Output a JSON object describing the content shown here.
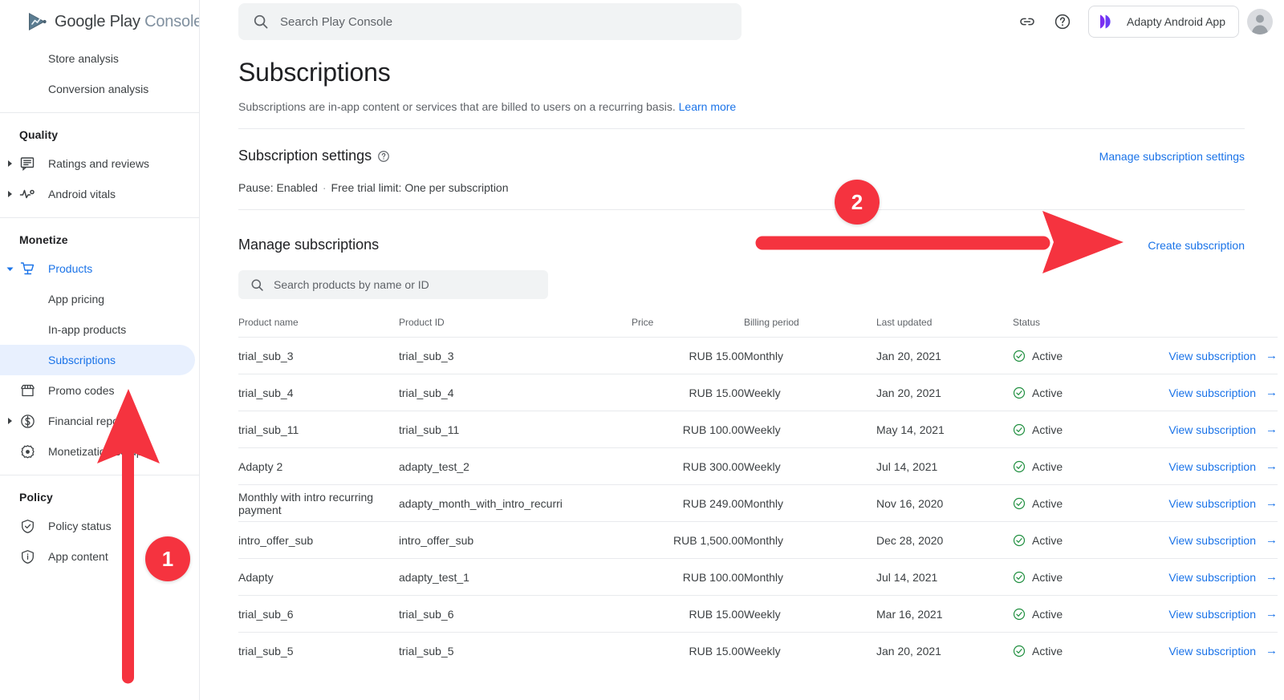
{
  "brand": {
    "name_primary": "Google Play",
    "name_secondary": "Console",
    "menu_icon": "hamburger-icon",
    "logo_icon": "google-play-logo-icon"
  },
  "topbar": {
    "search_placeholder": "Search Play Console",
    "search_value": "",
    "search_icon": "search-icon",
    "link_icon": "link-icon",
    "help_icon": "help-circle-icon",
    "app_name": "Adapty Android App",
    "app_icon": "adapty-app-icon",
    "avatar_icon": "account-avatar-icon"
  },
  "sidebar": {
    "items": [
      {
        "label": "Store analysis",
        "type": "sub",
        "icon": null,
        "state": "normal"
      },
      {
        "label": "Conversion analysis",
        "type": "sub",
        "icon": null,
        "state": "normal"
      }
    ],
    "sections": [
      {
        "title": "Quality",
        "items": [
          {
            "label": "Ratings and reviews",
            "icon": "ratings-reviews-icon",
            "caret": true,
            "state": "normal"
          },
          {
            "label": "Android vitals",
            "icon": "android-vitals-icon",
            "caret": true,
            "state": "normal"
          }
        ]
      },
      {
        "title": "Monetize",
        "items": [
          {
            "label": "Products",
            "icon": "shopping-cart-icon",
            "caret": true,
            "state": "expanded"
          },
          {
            "label": "App pricing",
            "icon": null,
            "caret": false,
            "state": "sub"
          },
          {
            "label": "In-app products",
            "icon": null,
            "caret": false,
            "state": "sub"
          },
          {
            "label": "Subscriptions",
            "icon": null,
            "caret": false,
            "state": "selected"
          },
          {
            "label": "Promo codes",
            "icon": "promo-codes-icon",
            "caret": false,
            "state": "normal"
          },
          {
            "label": "Financial reports",
            "icon": "financial-reports-icon",
            "caret": true,
            "state": "normal"
          },
          {
            "label": "Monetization setup",
            "icon": "monetization-setup-icon",
            "caret": false,
            "state": "normal"
          }
        ]
      },
      {
        "title": "Policy",
        "items": [
          {
            "label": "Policy status",
            "icon": "policy-status-icon",
            "caret": false,
            "state": "normal"
          },
          {
            "label": "App content",
            "icon": "app-content-icon",
            "caret": false,
            "state": "normal"
          }
        ]
      }
    ]
  },
  "page": {
    "title": "Subscriptions",
    "description": "Subscriptions are in-app content or services that are billed to users on a recurring basis.",
    "learn_more": "Learn more"
  },
  "subscription_settings": {
    "heading": "Subscription settings",
    "help_icon": "help-circle-icon",
    "manage_link": "Manage subscription settings",
    "pause": "Pause: Enabled",
    "separator": "·",
    "free_trial": "Free trial limit: One per subscription"
  },
  "manage_subscriptions": {
    "heading": "Manage subscriptions",
    "create_link": "Create subscription",
    "search_placeholder": "Search products by name or ID",
    "search_value": "",
    "search_icon": "search-icon",
    "columns": [
      "Product name",
      "Product ID",
      "Price",
      "Billing period",
      "Last updated",
      "Status"
    ],
    "action_label": "View subscription",
    "action_icon": "arrow-right-icon",
    "status_icon": "check-circle-icon",
    "rows": [
      {
        "name": "trial_sub_3",
        "id": "trial_sub_3",
        "price": "RUB 15.00",
        "billing": "Monthly",
        "updated": "Jan 20, 2021",
        "status": "Active",
        "action": "View subscription"
      },
      {
        "name": "trial_sub_4",
        "id": "trial_sub_4",
        "price": "RUB 15.00",
        "billing": "Weekly",
        "updated": "Jan 20, 2021",
        "status": "Active",
        "action": "View subscription"
      },
      {
        "name": "trial_sub_11",
        "id": "trial_sub_11",
        "price": "RUB 100.00",
        "billing": "Weekly",
        "updated": "May 14, 2021",
        "status": "Active",
        "action": "View subscription"
      },
      {
        "name": "Adapty 2",
        "id": "adapty_test_2",
        "price": "RUB 300.00",
        "billing": "Weekly",
        "updated": "Jul 14, 2021",
        "status": "Active",
        "action": "View subscription"
      },
      {
        "name": "Monthly with intro recurring payment",
        "id": "adapty_month_with_intro_recurri",
        "price": "RUB 249.00",
        "billing": "Monthly",
        "updated": "Nov 16, 2020",
        "status": "Active",
        "action": "View subscription"
      },
      {
        "name": "intro_offer_sub",
        "id": "intro_offer_sub",
        "price": "RUB 1,500.00",
        "billing": "Monthly",
        "updated": "Dec 28, 2020",
        "status": "Active",
        "action": "View subscription"
      },
      {
        "name": "Adapty",
        "id": "adapty_test_1",
        "price": "RUB 100.00",
        "billing": "Monthly",
        "updated": "Jul 14, 2021",
        "status": "Active",
        "action": "View subscription"
      },
      {
        "name": "trial_sub_6",
        "id": "trial_sub_6",
        "price": "RUB 15.00",
        "billing": "Weekly",
        "updated": "Mar 16, 2021",
        "status": "Active",
        "action": "View subscription"
      },
      {
        "name": "trial_sub_5",
        "id": "trial_sub_5",
        "price": "RUB 15.00",
        "billing": "Weekly",
        "updated": "Jan 20, 2021",
        "status": "Active",
        "action": "View subscription"
      }
    ]
  },
  "annotations": {
    "badge_1": "1",
    "badge_2": "2",
    "arrow_up": "arrow-up-annotation",
    "arrow_right": "arrow-right-annotation"
  },
  "colors": {
    "accent_blue": "#1a73e8",
    "annotation_red": "#f5333f",
    "status_green": "#1e8e3e",
    "highlight_bg": "#e8f0fe",
    "text_primary": "#202124",
    "text_secondary": "#5f6368"
  }
}
